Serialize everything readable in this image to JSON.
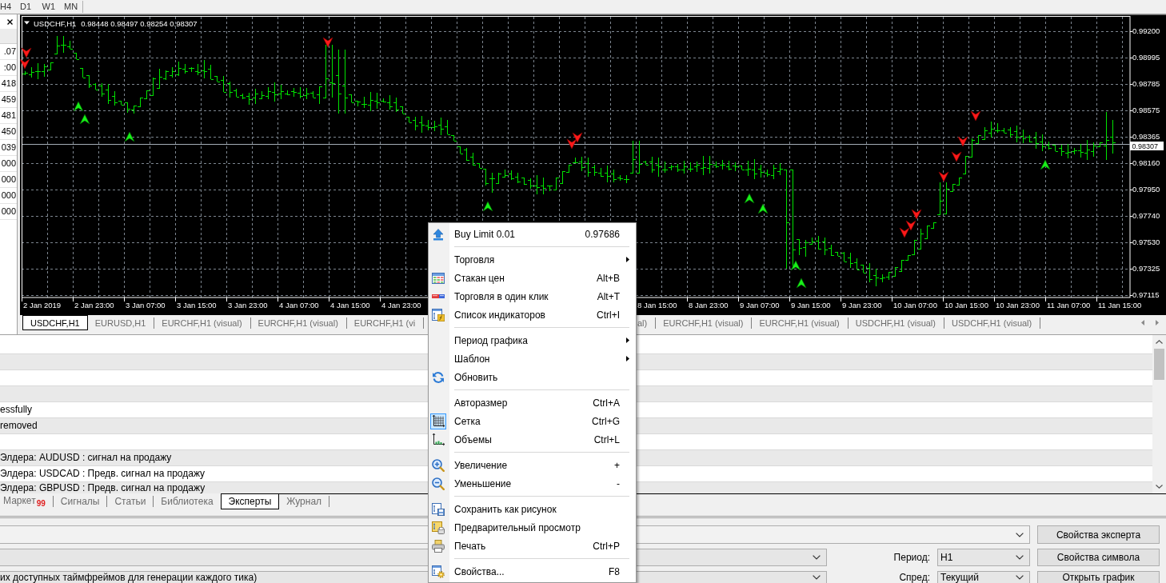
{
  "toolbar": {
    "timeframes": [
      "H4",
      "D1",
      "W1",
      "MN"
    ]
  },
  "market_watch": {
    "rows": [
      ".07",
      ":00",
      "418",
      "459",
      "481",
      "450",
      "039",
      "000",
      "000",
      "000",
      "000"
    ]
  },
  "chart": {
    "symbol": "USDCHF,H1",
    "ohlc": "0.98448 0.98497 0.98254 0.98307",
    "price_axis": [
      "0.99200",
      "0.98995",
      "0.98785",
      "0.98575",
      "0.98365",
      "0.98160",
      "0.97950",
      "0.97740",
      "0.97530",
      "0.97325",
      "0.97115"
    ],
    "current_price": "0.98307",
    "time_axis": [
      "2 Jan 2019",
      "2 Jan 23:00",
      "3 Jan 07:00",
      "3 Jan 15:00",
      "3 Jan 23:00",
      "4 Jan 07:00",
      "4 Jan 15:00",
      "4 Jan 23:00",
      "8 Jan 15:00",
      "8 Jan 23:00",
      "9 Jan 07:00",
      "9 Jan 15:00",
      "9 Jan 23:00",
      "10 Jan 07:00",
      "10 Jan 15:00",
      "10 Jan 23:00",
      "11 Jan 07:00",
      "11 Jan 15:00"
    ]
  },
  "chart_tabs": [
    {
      "label": "USDCHF,H1",
      "selected": true
    },
    {
      "label": "EURUSD,H1",
      "selected": false
    },
    {
      "label": "EURCHF,H1 (visual)",
      "selected": false
    },
    {
      "label": "EURCHF,H1 (visual)",
      "selected": false
    },
    {
      "label": "EURCHF,H1 (vi",
      "selected": false
    },
    {
      "label": "al)",
      "selected": false
    },
    {
      "label": "EURCHF,H1 (visual)",
      "selected": false
    },
    {
      "label": "EURCHF,H1 (visual)",
      "selected": false
    },
    {
      "label": "USDCHF,H1 (visual)",
      "selected": false
    },
    {
      "label": "USDCHF,H1 (visual)",
      "selected": false
    }
  ],
  "journal": {
    "rows": [
      {},
      {},
      {},
      {},
      {
        "message": "essfully"
      },
      {
        "message": "removed"
      },
      {},
      {
        "message": "Элдера: AUDUSD : сигнал на продажу"
      },
      {
        "message": "Элдера: USDCAD : Предв. сигнал на продажу"
      },
      {
        "message": "Элдера: GBPUSD : Предв. сигнал на продажу"
      }
    ]
  },
  "terminal_tabs": [
    {
      "label": "Маркет",
      "badge": "99",
      "selected": false
    },
    {
      "label": "Сигналы",
      "selected": false
    },
    {
      "label": "Статьи",
      "selected": false
    },
    {
      "label": "Библиотека",
      "selected": false
    },
    {
      "label": "Эксперты",
      "selected": true
    },
    {
      "label": "Журнал",
      "selected": false
    }
  ],
  "tester": {
    "rows": [
      {
        "button": "Свойства эксперта"
      },
      {
        "label": "Период:",
        "value": "H1",
        "button": "Свойства символа"
      },
      {
        "field_value": "их доступных таймфреймов для генерации каждого тика)",
        "label": "Спред:",
        "value": "Текущий",
        "button": "Открыть график"
      }
    ]
  },
  "context_menu": {
    "groups": [
      {
        "items": [
          {
            "label": "Buy Limit 0.01",
            "price": "0.97686",
            "submenu": false,
            "checked": false
          }
        ]
      },
      {
        "items": [
          {
            "label": "Торговля",
            "submenu": true,
            "checked": false
          },
          {
            "label": "Стакан цен",
            "shortcut": "Alt+B",
            "submenu": false,
            "checked": false
          },
          {
            "label": "Торговля в один клик",
            "shortcut": "Alt+T",
            "submenu": false,
            "checked": false
          },
          {
            "label": "Список индикаторов",
            "shortcut": "Ctrl+I",
            "submenu": false,
            "checked": false
          }
        ]
      },
      {
        "items": [
          {
            "label": "Период графика",
            "submenu": true,
            "checked": false
          },
          {
            "label": "Шаблон",
            "submenu": true,
            "checked": false
          },
          {
            "label": "Обновить",
            "submenu": false,
            "checked": false
          }
        ]
      },
      {
        "items": [
          {
            "label": "Авторазмер",
            "shortcut": "Ctrl+A",
            "submenu": false,
            "checked": false
          },
          {
            "label": "Сетка",
            "shortcut": "Ctrl+G",
            "submenu": false,
            "checked": true
          },
          {
            "label": "Объемы",
            "shortcut": "Ctrl+L",
            "submenu": false,
            "checked": false
          }
        ]
      },
      {
        "items": [
          {
            "label": "Увеличение",
            "shortcut": "+",
            "submenu": false,
            "checked": false
          },
          {
            "label": "Уменьшение",
            "shortcut": "-",
            "submenu": false,
            "checked": false
          }
        ]
      },
      {
        "items": [
          {
            "label": "Сохранить как рисунок",
            "submenu": false,
            "checked": false
          },
          {
            "label": "Предварительный просмотр",
            "submenu": false,
            "checked": false
          },
          {
            "label": "Печать",
            "shortcut": "Ctrl+P",
            "submenu": false,
            "checked": false
          }
        ]
      },
      {
        "items": [
          {
            "label": "Свойства...",
            "shortcut": "F8",
            "submenu": false,
            "checked": false
          }
        ]
      }
    ]
  }
}
